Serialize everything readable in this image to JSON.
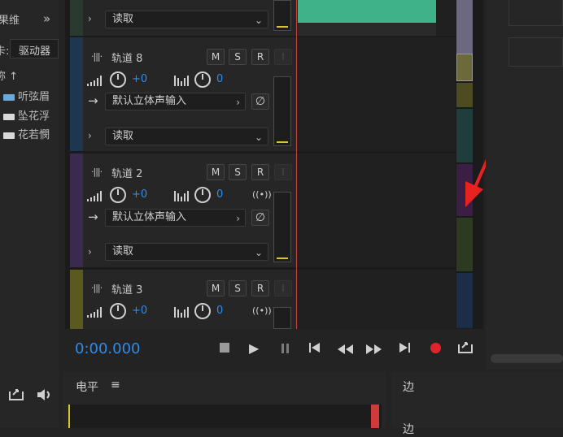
{
  "left_panel": {
    "title_fragment": "果维",
    "expand_icon": "»",
    "drive_label": "卡:",
    "drive_select": "驱动器",
    "name_header": "称 ↑",
    "items": [
      "听弦眉",
      "坠花浮",
      "花若憫"
    ],
    "bottom_icons": [
      "export-icon",
      "speaker-icon"
    ]
  },
  "tracks": [
    {
      "name": "",
      "read_mode": "读取",
      "color": "#2b3a2f"
    },
    {
      "name": "轨道 8",
      "volume": "+0",
      "pan": "0",
      "input": "默认立体声输入",
      "read_mode": "读取",
      "buttons": [
        "M",
        "S",
        "R",
        "I"
      ],
      "color": "#1f3650"
    },
    {
      "name": "轨道 2",
      "volume": "+0",
      "pan": "0",
      "input": "默认立体声输入",
      "read_mode": "读取",
      "buttons": [
        "M",
        "S",
        "R",
        "I"
      ],
      "color": "#3a2a4e"
    },
    {
      "name": "轨道 3",
      "volume": "+0",
      "pan": "0",
      "buttons": [
        "M",
        "S",
        "R",
        "I"
      ],
      "color": "#5a5a20"
    }
  ],
  "transport": {
    "timecode": "0:00.000",
    "buttons": [
      "stop",
      "play",
      "pause",
      "go-to-start",
      "rewind",
      "fast-forward",
      "go-to-end",
      "record",
      "loop"
    ]
  },
  "level_panel": {
    "title": "电平",
    "menu_icon": "≡"
  },
  "right_bottom": {
    "label1": "边",
    "label2": "边"
  },
  "annotation": {
    "arrow_color": "#e8231f"
  }
}
